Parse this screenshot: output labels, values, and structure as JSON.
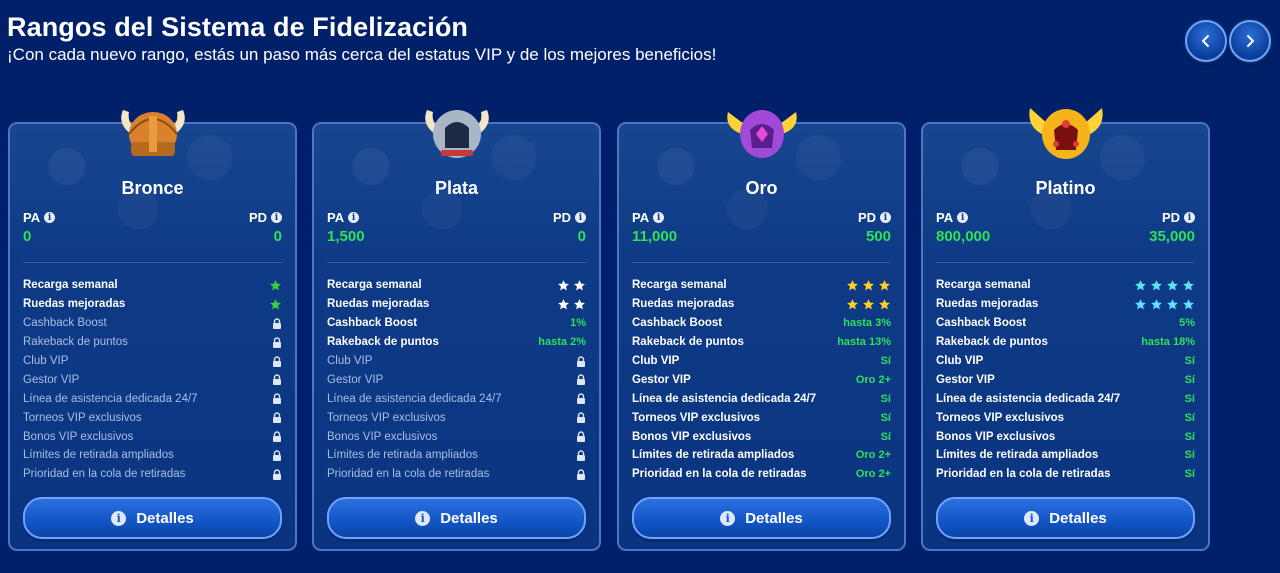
{
  "header": {
    "title": "Rangos del Sistema de Fidelización",
    "subtitle": "¡Con cada nuevo rango, estás un paso más cerca del estatus VIP y de los mejores beneficios!"
  },
  "nav": {
    "prev_icon": "chevron-left-icon",
    "next_icon": "chevron-right-icon"
  },
  "colors": {
    "background": "#00216a",
    "card": "#0f3b86",
    "value_green": "#2ee05a",
    "bronze_star": "#3ccf3c",
    "silver_star": "#ffffff",
    "gold_star": "#ffd21f",
    "platinum_star": "#5fe0ff"
  },
  "labels": {
    "pa": "PA",
    "pd": "PD",
    "details": "Detalles",
    "info_icon": "i"
  },
  "features": [
    "Recarga semanal",
    "Ruedas mejoradas",
    "Cashback Boost",
    "Rakeback de puntos",
    "Club VIP",
    "Gestor VIP",
    "Línea de asistencia dedicada 24/7",
    "Torneos VIP exclusivos",
    "Bonos VIP exclusivos",
    "Límites de retirada ampliados",
    "Prioridad en la cola de retiradas"
  ],
  "ranks": [
    {
      "name": "Bronce",
      "helmet_icon": "bronze-viking-helmet-icon",
      "pa": "0",
      "pd": "0",
      "values": [
        "1 star",
        "1 star",
        "locked",
        "locked",
        "locked",
        "locked",
        "locked",
        "locked",
        "locked",
        "locked",
        "locked"
      ]
    },
    {
      "name": "Plata",
      "helmet_icon": "silver-viking-helmet-icon",
      "pa": "1,500",
      "pd": "0",
      "values": [
        "2 stars",
        "2 stars",
        "1%",
        "hasta 2%",
        "locked",
        "locked",
        "locked",
        "locked",
        "locked",
        "locked",
        "locked"
      ]
    },
    {
      "name": "Oro",
      "helmet_icon": "purple-winged-helmet-icon",
      "pa": "11,000",
      "pd": "500",
      "values": [
        "3 stars",
        "3 stars",
        "hasta 3%",
        "hasta 13%",
        "Sí",
        "Oro 2+",
        "Sí",
        "Sí",
        "Sí",
        "Oro 2+",
        "Oro 2+"
      ]
    },
    {
      "name": "Platino",
      "helmet_icon": "gold-winged-helmet-icon",
      "pa": "800,000",
      "pd": "35,000",
      "values": [
        "4 stars",
        "4 stars",
        "5%",
        "hasta 18%",
        "Sí",
        "Sí",
        "Sí",
        "Sí",
        "Sí",
        "Sí",
        "Sí"
      ]
    }
  ]
}
